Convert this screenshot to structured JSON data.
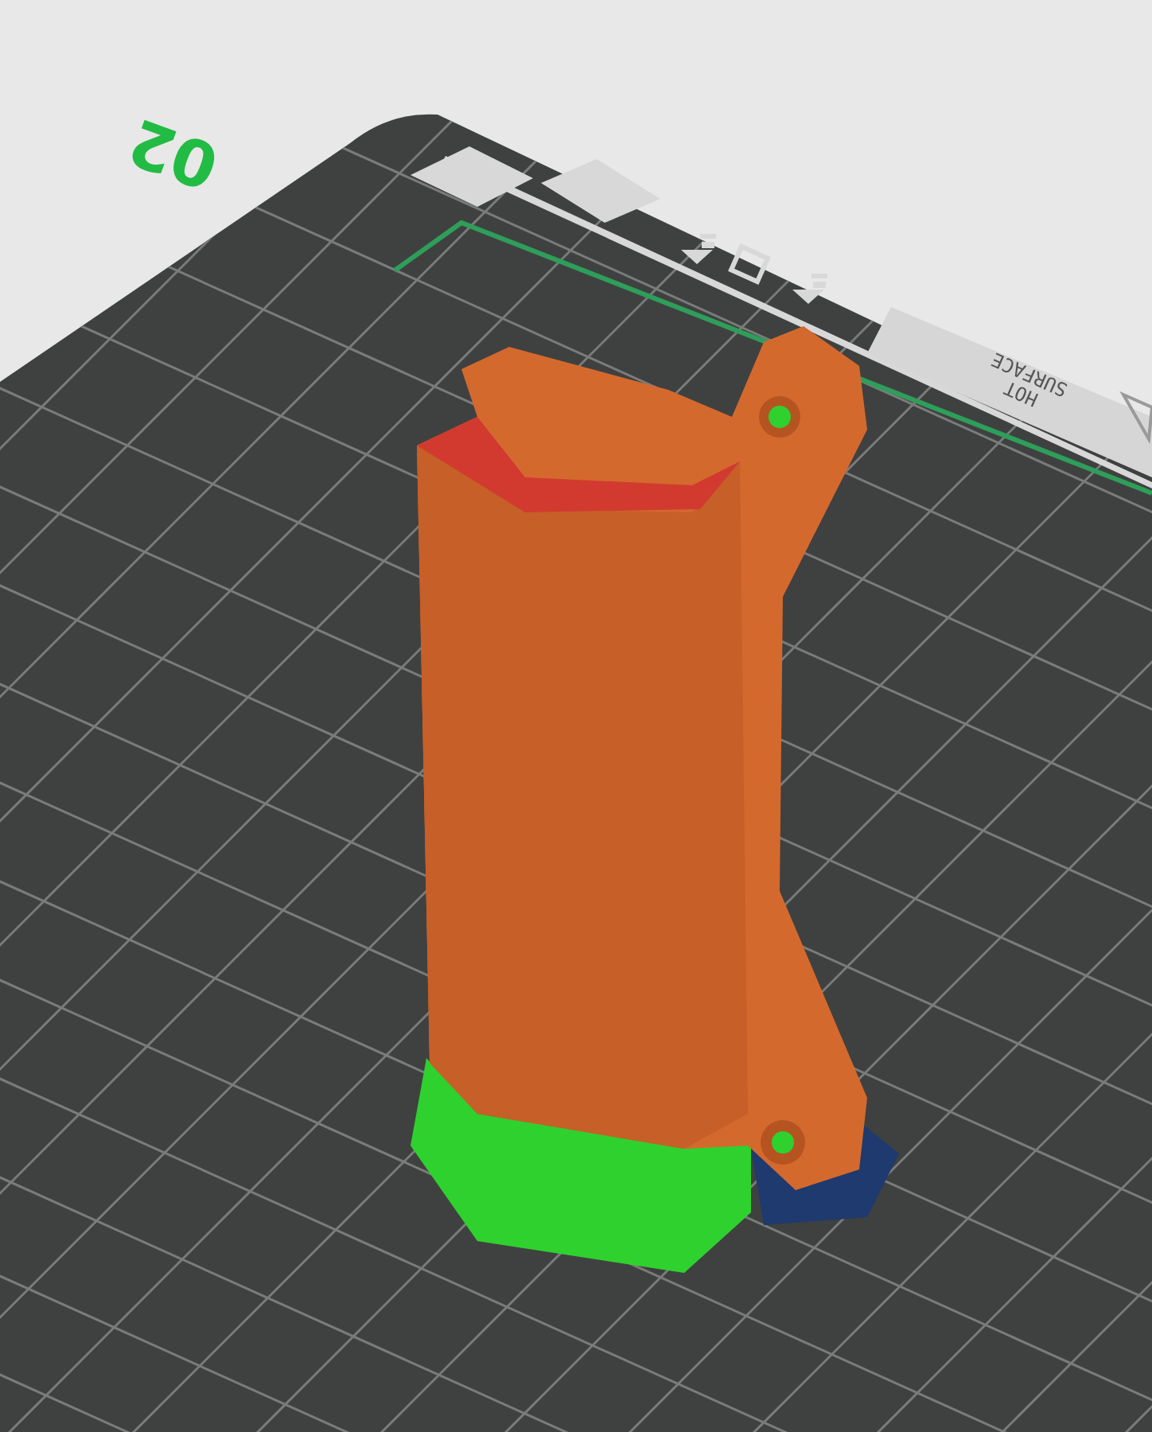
{
  "viewport": {
    "bed_number": "02",
    "warning_label": [
      "HOT",
      "SURFACE"
    ]
  }
}
